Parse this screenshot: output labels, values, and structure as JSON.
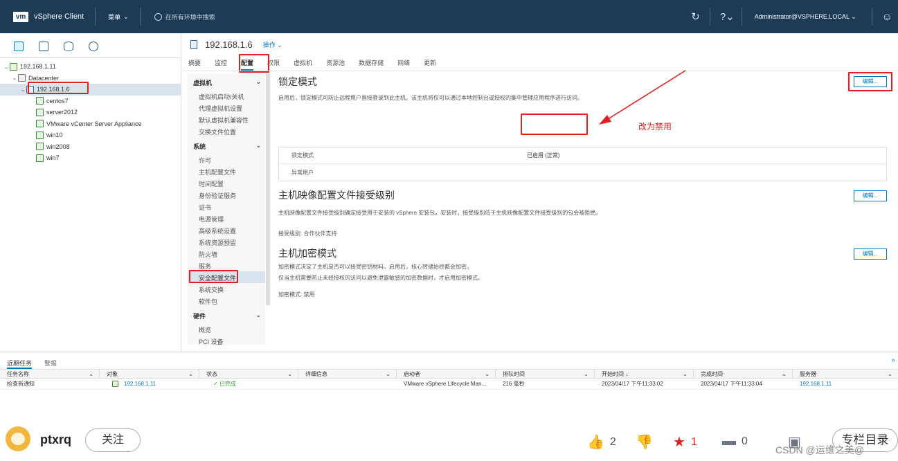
{
  "header": {
    "logo": "vm",
    "app_title": "vSphere Client",
    "menu_label": "菜单",
    "search_placeholder": "在所有环境中搜索",
    "user": "Administrator@VSPHERE.LOCAL"
  },
  "tree": {
    "vcenter": "192.168.1.11",
    "datacenter": "Datacenter",
    "host": "192.168.1.6",
    "vms": [
      "centos7",
      "server2012",
      "VMware vCenter Server Appliance",
      "win10",
      "win2008",
      "win7"
    ]
  },
  "main": {
    "host_title": "192.168.1.6",
    "actions_label": "操作",
    "tabs": [
      "摘要",
      "监控",
      "配置",
      "权限",
      "虚拟机",
      "资源池",
      "数据存储",
      "网络",
      "更新"
    ],
    "subnav": {
      "group_vm": "虚拟机",
      "vm_items": [
        "虚拟机启动/关机",
        "代理虚拟机设置",
        "默认虚拟机兼容性",
        "交换文件位置"
      ],
      "group_system": "系统",
      "system_items": [
        "许可",
        "主机配置文件",
        "时间配置",
        "身份验证服务",
        "证书",
        "电源管理",
        "高级系统设置",
        "系统资源预留",
        "防火墙",
        "服务",
        "安全配置文件",
        "系统交换",
        "软件包"
      ],
      "group_hw": "硬件",
      "hw_items": [
        "概览",
        "PCI 设备"
      ]
    },
    "lockdown": {
      "title": "锁定模式",
      "desc": "启用后，锁定模式可防止远程用户直接登录到此主机。该主机将仅可以通过本地控制台或授权的集中管理应用程序进行访问。",
      "edit": "编辑...",
      "rows": [
        {
          "k": "锁定模式",
          "v": "已启用 (正常)"
        },
        {
          "k": "异常用户",
          "v": ""
        }
      ]
    },
    "image_profile": {
      "title": "主机映像配置文件接受级别",
      "desc": "主机映像配置文件接受级别确定接受用于安装的 vSphere 安装包。安装时，接受级别低于主机映像配置文件接受级别的包会被拒绝。",
      "level": "接受级别: 合作伙伴支持",
      "edit": "编辑..."
    },
    "encryption": {
      "title": "主机加密模式",
      "desc1": "加密模式决定了主机是否可以接受密钥材料。启用后，核心转储始终都会加密。",
      "desc2": "仅当主机需要防止未经授权的访问以避免泄露敏感的加密数据时，才启用加密模式。",
      "mode": "加密模式: 禁用",
      "edit": "编辑..."
    },
    "annotation": "改为禁用"
  },
  "tasks": {
    "tabs": [
      "近期任务",
      "警报"
    ],
    "columns": [
      "任务名称",
      "对象",
      "状态",
      "详细信息",
      "启动者",
      "排队时间",
      "开始时间 ↓",
      "完成时间",
      "服务器"
    ],
    "rows": [
      {
        "name": "检查新通知",
        "object": "192.168.1.11",
        "status": "✓ 已完成",
        "details": "",
        "initiator": "VMware vSphere Lifecycle Man...",
        "queued": "216 毫秒",
        "start": "2023/04/17 下午11:33:02",
        "end": "2023/04/17 下午11:33:04",
        "server": "192.168.1.11"
      }
    ]
  },
  "footer": {
    "username": "ptxrq",
    "follow": "关注",
    "likes": "2",
    "favorites": "1",
    "comments": "0",
    "watermark": "CSDN @运维之美@",
    "column_btn": "专栏目录"
  }
}
